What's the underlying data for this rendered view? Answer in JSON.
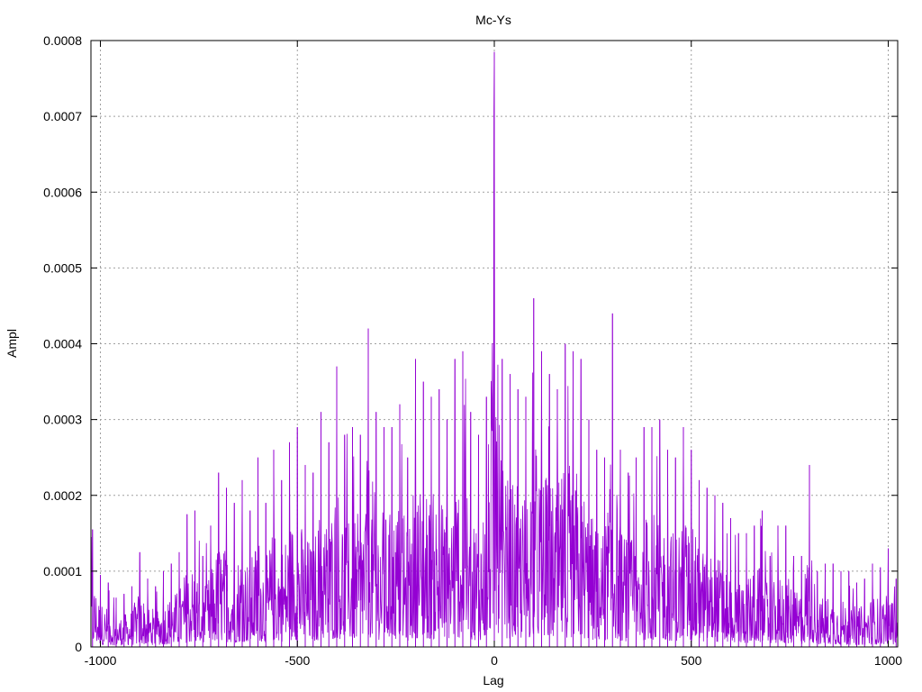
{
  "chart_data": {
    "type": "line",
    "title": "Mc-Ys",
    "xlabel": "Lag",
    "ylabel": "Ampl",
    "xlim": [
      -1024,
      1024
    ],
    "ylim": [
      0,
      0.0008
    ],
    "x_ticks": [
      -1000,
      -500,
      0,
      500,
      1000
    ],
    "x_tick_labels": [
      "-1000",
      "-500",
      "0",
      "500",
      "1000"
    ],
    "y_ticks": [
      0,
      0.0001,
      0.0002,
      0.0003,
      0.0004,
      0.0005,
      0.0006,
      0.0007,
      0.0008
    ],
    "y_tick_labels": [
      "0",
      "0.0001",
      "0.0002",
      "0.0003",
      "0.0004",
      "0.0005",
      "0.0006",
      "0.0007",
      "0.0008"
    ],
    "grid": true,
    "legend": "none",
    "series_color": "#9400D3",
    "series": [
      {
        "x": [
          -1020,
          -1000,
          -980,
          -960,
          -940,
          -920,
          -900,
          -880,
          -860,
          -840,
          -820,
          -800,
          -780,
          -760,
          -740,
          -720,
          -700,
          -680,
          -660,
          -640,
          -620,
          -600,
          -580,
          -560,
          -540,
          -520,
          -500,
          -480,
          -460,
          -440,
          -420,
          -400,
          -380,
          -360,
          -340,
          -320,
          -300,
          -280,
          -260,
          -240,
          -220,
          -200,
          -180,
          -160,
          -140,
          -120,
          -100,
          -80,
          -60,
          -40,
          -20,
          0,
          20,
          40,
          60,
          80,
          100,
          120,
          140,
          160,
          180,
          200,
          220,
          240,
          260,
          280,
          300,
          320,
          340,
          360,
          380,
          400,
          420,
          440,
          460,
          480,
          500,
          520,
          540,
          560,
          580,
          600,
          620,
          640,
          660,
          680,
          700,
          720,
          740,
          760,
          780,
          800,
          820,
          840,
          860,
          880,
          900,
          920,
          940,
          960,
          980,
          1000,
          1020
        ],
        "y": [
          0.000155,
          9.5e-05,
          8.5e-05,
          6.5e-05,
          7e-05,
          8e-05,
          0.000125,
          9e-05,
          8e-05,
          0.0001,
          0.00011,
          0.000125,
          0.000175,
          0.00018,
          0.00012,
          0.00016,
          0.00023,
          0.00021,
          0.00019,
          0.00022,
          0.00018,
          0.00025,
          0.00019,
          0.00026,
          0.00022,
          0.00027,
          0.00029,
          0.00024,
          0.00023,
          0.00031,
          0.00027,
          0.00037,
          0.00028,
          0.00029,
          0.00028,
          0.00042,
          0.00031,
          0.00029,
          0.00029,
          0.00032,
          0.00025,
          0.00038,
          0.00035,
          0.00033,
          0.00034,
          0.0003,
          0.00038,
          0.00039,
          0.00031,
          0.00028,
          0.00033,
          0.000785,
          0.00038,
          0.00036,
          0.00034,
          0.00033,
          0.00046,
          0.00039,
          0.00036,
          0.00034,
          0.0004,
          0.00039,
          0.00038,
          0.0003,
          0.00026,
          0.00025,
          0.00044,
          0.00026,
          0.00023,
          0.00025,
          0.00029,
          0.00029,
          0.0003,
          0.00026,
          0.00025,
          0.00029,
          0.00026,
          0.00022,
          0.00021,
          0.0002,
          0.00019,
          0.00017,
          0.00015,
          0.00015,
          0.00016,
          0.00018,
          0.00012,
          0.00016,
          0.00016,
          0.00012,
          0.00012,
          0.00024,
          0.0001,
          0.00011,
          0.00011,
          0.0001,
          0.0001,
          8.5e-05,
          9e-05,
          0.00011,
          0.000105,
          0.00013,
          9e-05
        ]
      }
    ]
  }
}
